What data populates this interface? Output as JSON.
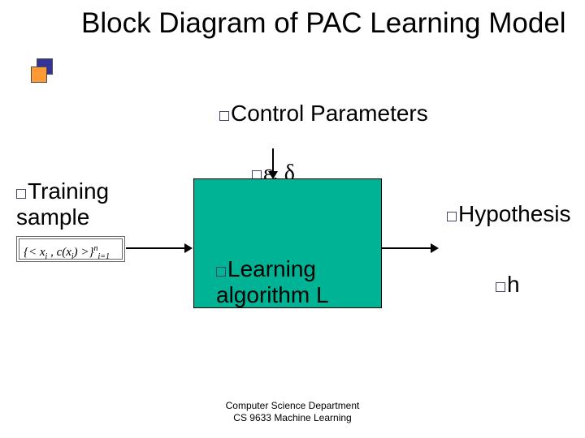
{
  "title": "Block Diagram of PAC Learning Model",
  "labels": {
    "control": "Control Parameters",
    "eps_delta": "ε, δ",
    "training": "Training sample",
    "hypothesis": "Hypothesis",
    "h": "h",
    "learning": "Learning algorithm L"
  },
  "formula_html": "{&lt; x<sub>i</sub> , c(x<sub>i</sub>) &gt;}<sup>n</sup><sub>i=1</sub>",
  "footer": {
    "line1": "Computer Science Department",
    "line2": "CS 9633 Machine Learning"
  },
  "colors": {
    "box_fill": "#00b394",
    "title_accent_blue": "#333399",
    "title_accent_orange": "#ff9933"
  }
}
